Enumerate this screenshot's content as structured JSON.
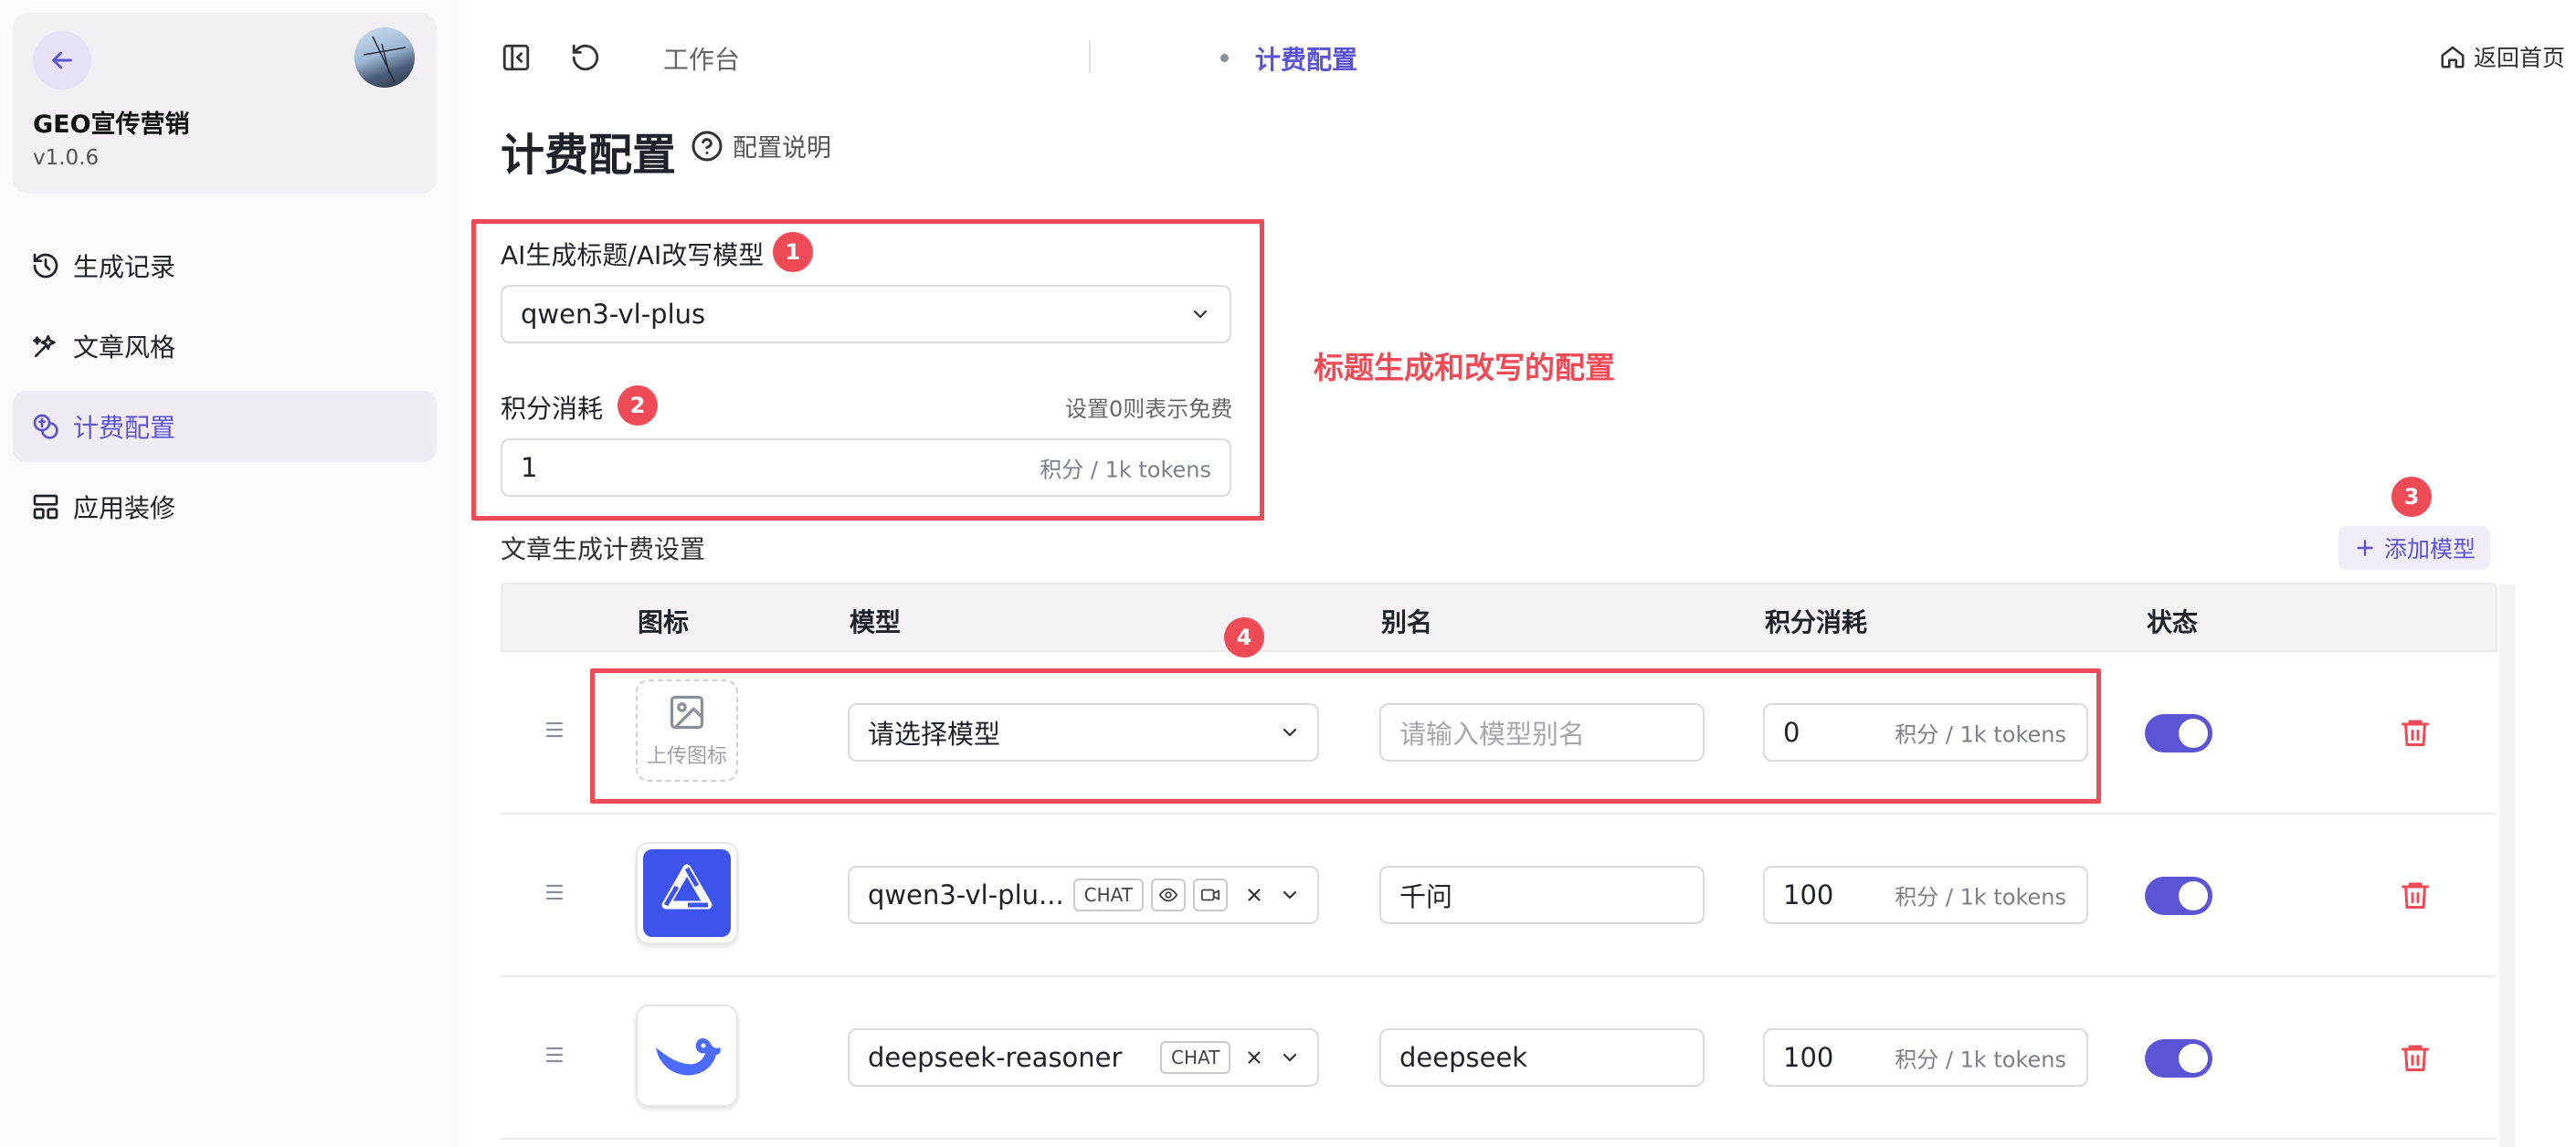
{
  "app": {
    "name": "GEO宣传营销",
    "version": "v1.0.6"
  },
  "sidebar": {
    "items": [
      {
        "label": "生成记录",
        "icon": "history-icon",
        "active": false
      },
      {
        "label": "文章风格",
        "icon": "sparkle-icon",
        "active": false
      },
      {
        "label": "计费配置",
        "icon": "coins-icon",
        "active": true
      },
      {
        "label": "应用装修",
        "icon": "layout-icon",
        "active": false
      }
    ]
  },
  "header": {
    "breadcrumb": [
      "工作台",
      "计费配置"
    ],
    "home_label": "返回首页"
  },
  "page": {
    "title": "计费配置",
    "help_label": "配置说明"
  },
  "annotations": {
    "badges": [
      "1",
      "2",
      "3",
      "4"
    ],
    "note": "标题生成和改写的配置",
    "color": "#ef4b56"
  },
  "title_config": {
    "model_label": "AI生成标题/AI改写模型",
    "model_value": "qwen3-vl-plus",
    "points_label": "积分消耗",
    "points_hint": "设置0则表示免费",
    "points_value": "1",
    "points_suffix": "积分 / 1k tokens"
  },
  "article_billing": {
    "section_title": "文章生成计费设置",
    "add_button": "添加模型",
    "columns": [
      "图标",
      "模型",
      "别名",
      "积分消耗",
      "状态"
    ],
    "rows": [
      {
        "icon": "upload",
        "upload_label": "上传图标",
        "model": "请选择模型",
        "tags": [],
        "alias": "",
        "alias_placeholder": "请输入模型别名",
        "points": "0",
        "points_suffix": "积分 / 1k tokens",
        "enabled": true
      },
      {
        "icon": "qwen-logo",
        "model": "qwen3-vl-plu...",
        "tags": [
          "CHAT"
        ],
        "capabilities": [
          "eye-icon",
          "video-icon"
        ],
        "alias": "千问",
        "points": "100",
        "points_suffix": "积分 / 1k tokens",
        "enabled": true
      },
      {
        "icon": "deepseek-logo",
        "model": "deepseek-reasoner",
        "tags": [
          "CHAT"
        ],
        "alias": "deepseek",
        "points": "100",
        "points_suffix": "积分 / 1k tokens",
        "enabled": true
      }
    ]
  },
  "colors": {
    "accent": "#5b55d6",
    "danger": "#ef4b56"
  }
}
